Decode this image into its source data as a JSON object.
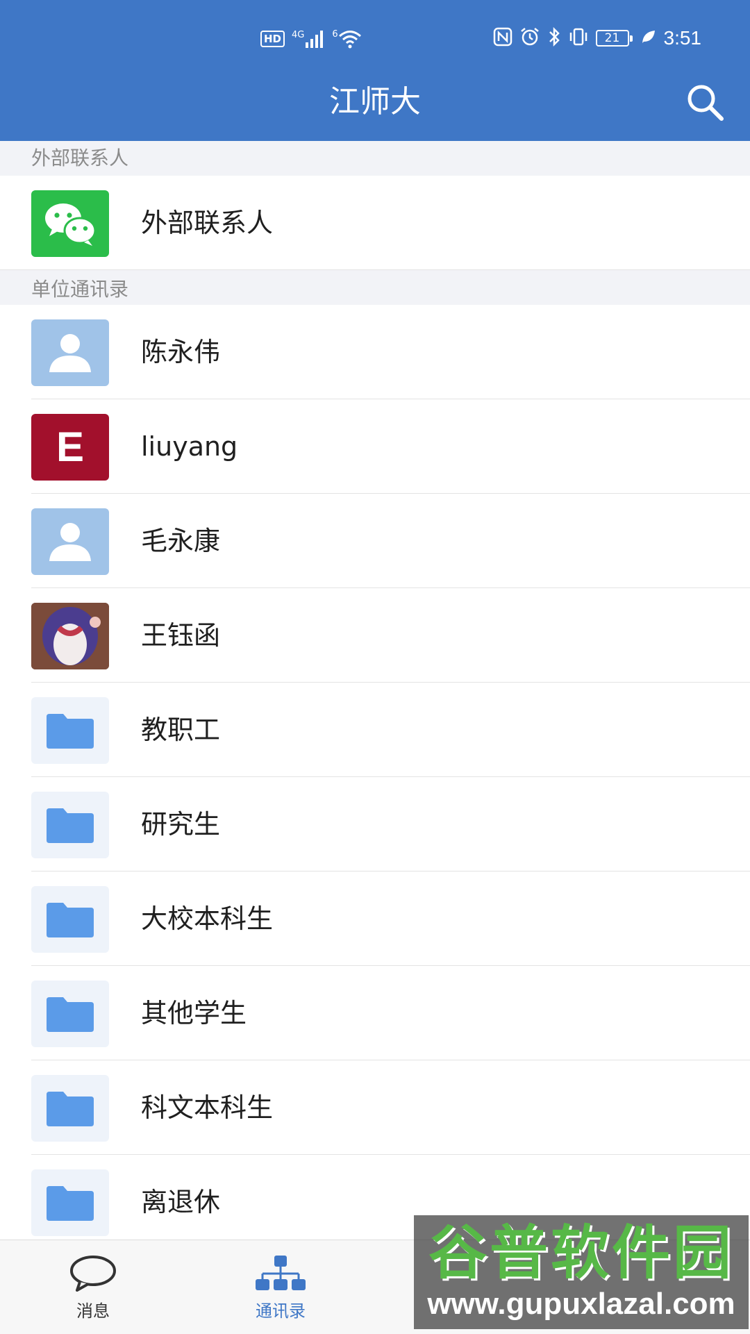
{
  "status_bar": {
    "hd": "HD",
    "network": "4G",
    "wifi_tag": "6",
    "battery": "21",
    "time": "3:51"
  },
  "header": {
    "title": "江师大",
    "search_icon": "search-icon"
  },
  "sections": [
    {
      "title": "外部联系人",
      "rows": [
        {
          "label": "外部联系人",
          "icon": "wechat-icon"
        }
      ]
    },
    {
      "title": "单位通讯录",
      "rows": [
        {
          "label": "陈永伟",
          "icon": "default-person-avatar"
        },
        {
          "label": "liuyang",
          "icon": "letter-avatar",
          "avatar_text": "E"
        },
        {
          "label": "毛永康",
          "icon": "default-person-avatar"
        },
        {
          "label": "王钰函",
          "icon": "cartoon-avatar"
        },
        {
          "label": "教职工",
          "icon": "folder-icon"
        },
        {
          "label": "研究生",
          "icon": "folder-icon"
        },
        {
          "label": "大校本科生",
          "icon": "folder-icon"
        },
        {
          "label": "其他学生",
          "icon": "folder-icon"
        },
        {
          "label": "科文本科生",
          "icon": "folder-icon"
        },
        {
          "label": "离退休",
          "icon": "folder-icon"
        }
      ]
    }
  ],
  "bottom_nav": {
    "items": [
      {
        "label": "消息",
        "icon": "chat-bubble-icon",
        "active": false
      },
      {
        "label": "通讯录",
        "icon": "org-chart-icon",
        "active": true
      }
    ]
  },
  "watermark": {
    "title": "谷普软件园",
    "url": "www.gupuxlazal.com"
  },
  "colors": {
    "primary": "#3f77c6",
    "wechat_green": "#2bbd4a",
    "folder_blue": "#5b9be8"
  }
}
